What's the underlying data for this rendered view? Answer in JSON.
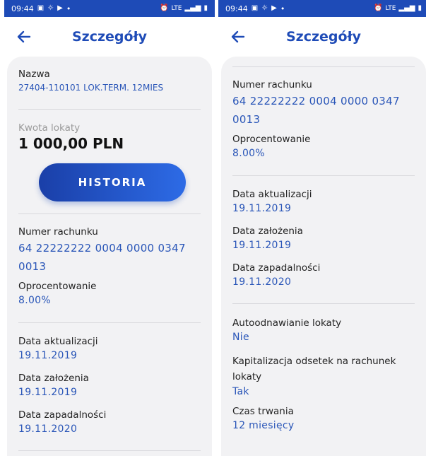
{
  "status_bar": {
    "time": "09:44",
    "dot": "•",
    "network": "LTE"
  },
  "header": {
    "title": "Szczegóły"
  },
  "details": {
    "name_label": "Nazwa",
    "name_value": "27404-110101 LOK.TERM. 12MIES",
    "amount_label": "Kwota lokaty",
    "amount_value": "1 000,00 PLN",
    "history_button": "HISTORIA",
    "account_label": "Numer rachunku",
    "account_line1": "64 22222222 0004 0000 0347",
    "account_line2": "0013",
    "rate_label": "Oprocentowanie",
    "rate_value": "8.00%",
    "update_label": "Data aktualizacji",
    "update_value": "19.11.2019",
    "created_label": "Data założenia",
    "created_value": "19.11.2019",
    "maturity_label": "Data zapadalności",
    "maturity_value": "19.11.2020",
    "renewal_label": "Autoodnawianie lokaty",
    "renewal_value": "Nie",
    "capital_label_line1": "Kapitalizacja odsetek na rachunek",
    "capital_label_line2": "lokaty",
    "capital_value": "Tak",
    "duration_label": "Czas trwania",
    "duration_value": "12 miesięcy"
  },
  "colors": {
    "primary": "#1e4bb7",
    "value_text": "#2a56b8",
    "card_bg": "#f2f2f4"
  }
}
